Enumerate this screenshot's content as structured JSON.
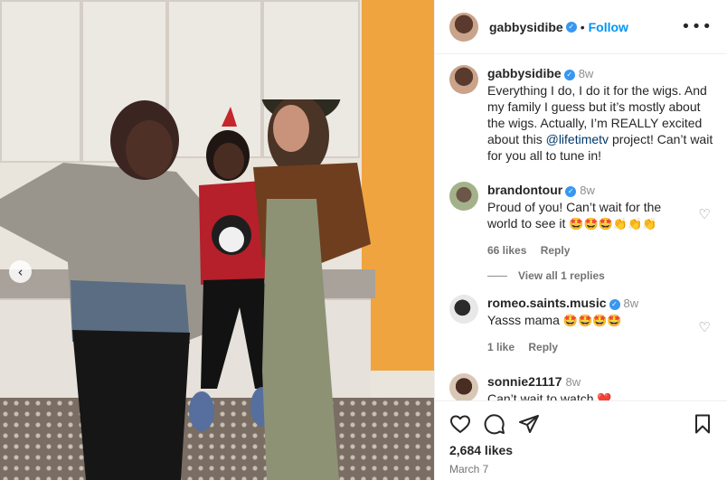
{
  "post": {
    "author": "gabbysidibe",
    "follow_label": "Follow",
    "separator": "•",
    "more_label": "•••",
    "likes": "2,684 likes",
    "date": "March 7"
  },
  "caption": {
    "username": "gabbysidibe",
    "time": "8w",
    "text_before": "Everything I do, I do it for the wigs. And my family I guess but it’s mostly about the wigs. Actually, I’m REALLY excited about this ",
    "mention": "@lifetimetv",
    "text_after": " project! Can’t wait for you all to tune in!"
  },
  "comments": [
    {
      "username": "brandontour",
      "time": "8w",
      "text": "Proud of you! Can’t wait for the world to see it ",
      "emojis": "🤩🤩🤩👏👏👏",
      "likes": "66 likes",
      "reply": "Reply",
      "view_replies": "View all 1 replies"
    },
    {
      "username": "romeo.saints.music",
      "time": "8w",
      "text": "Yasss mama ",
      "emojis": "🤩🤩🤩🤩",
      "likes": "1 like",
      "reply": "Reply"
    },
    {
      "username": "sonnie21117",
      "time": "8w",
      "text": "Can’t wait to watch ",
      "emojis": "❤️"
    }
  ],
  "icons": {
    "like": "heart-icon",
    "comment": "comment-icon",
    "share": "share-icon",
    "save": "bookmark-icon",
    "prev": "chevron-left-icon"
  },
  "nav": {
    "prev_glyph": "‹"
  },
  "colors": {
    "accent": "#0095f6",
    "verified": "#3897f0",
    "wall": "#f0a440"
  }
}
